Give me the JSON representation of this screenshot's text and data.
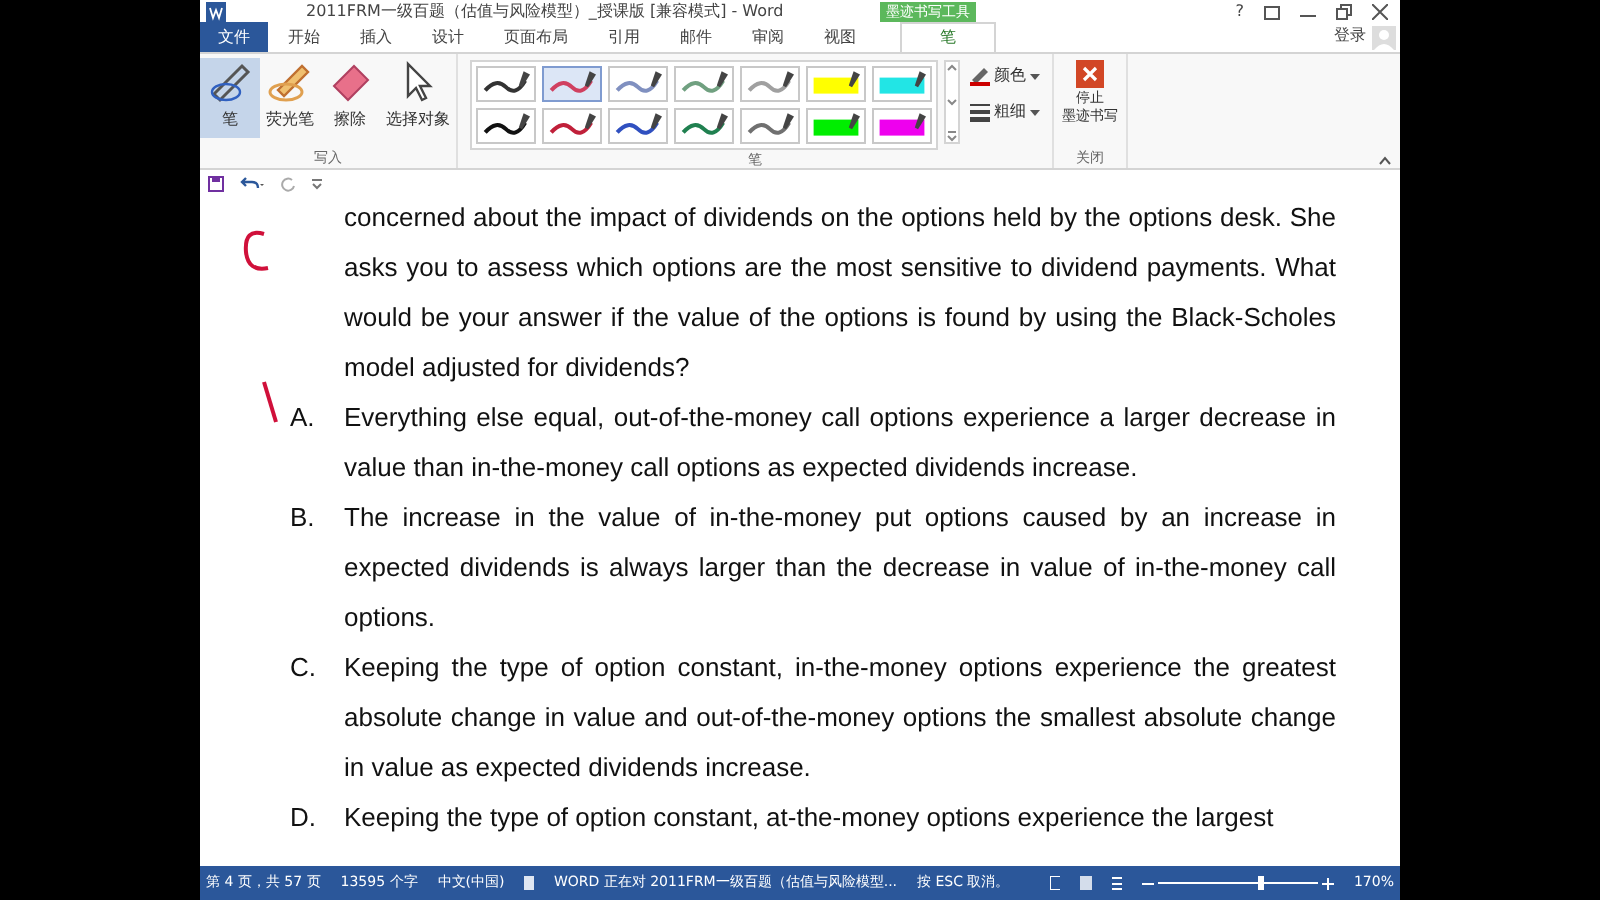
{
  "window": {
    "title": "2011FRM一级百题（估值与风险模型）_授课版 [兼容模式] - Word",
    "context_label": "墨迹书写工具",
    "account": "登录",
    "help": "?"
  },
  "tabs": [
    {
      "label": "文件",
      "selected": false,
      "kind": "file"
    },
    {
      "label": "开始",
      "selected": false,
      "kind": "tab"
    },
    {
      "label": "插入",
      "selected": false,
      "kind": "tab"
    },
    {
      "label": "设计",
      "selected": false,
      "kind": "tab"
    },
    {
      "label": "页面布局",
      "selected": false,
      "kind": "tab"
    },
    {
      "label": "引用",
      "selected": false,
      "kind": "tab"
    },
    {
      "label": "邮件",
      "selected": false,
      "kind": "tab"
    },
    {
      "label": "审阅",
      "selected": false,
      "kind": "tab"
    },
    {
      "label": "视图",
      "selected": false,
      "kind": "tab"
    },
    {
      "label": "笔",
      "selected": true,
      "kind": "tab"
    }
  ],
  "ribbon": {
    "write_group": {
      "label": "写入",
      "tools": [
        {
          "label": "笔",
          "selected": true,
          "kind": "pen"
        },
        {
          "label": "荧光笔",
          "selected": false,
          "kind": "highlighter"
        },
        {
          "label": "擦除",
          "selected": false,
          "kind": "eraser"
        },
        {
          "label": "选择对象",
          "selected": false,
          "kind": "select"
        }
      ]
    },
    "pens_group": {
      "label": "笔",
      "pens": [
        {
          "color": "#333333",
          "selected": false,
          "kind": "line"
        },
        {
          "color": "#d04060",
          "selected": true,
          "kind": "line"
        },
        {
          "color": "#8090c0",
          "selected": false,
          "kind": "line"
        },
        {
          "color": "#70a080",
          "selected": false,
          "kind": "line"
        },
        {
          "color": "#a0a0a0",
          "selected": false,
          "kind": "line"
        },
        {
          "color": "#ffff00",
          "selected": false,
          "kind": "highlight"
        },
        {
          "color": "#22e5e5",
          "selected": false,
          "kind": "highlight"
        },
        {
          "color": "#111111",
          "selected": false,
          "kind": "line"
        },
        {
          "color": "#c0203a",
          "selected": false,
          "kind": "line"
        },
        {
          "color": "#3050c0",
          "selected": false,
          "kind": "line"
        },
        {
          "color": "#208050",
          "selected": false,
          "kind": "line"
        },
        {
          "color": "#707070",
          "selected": false,
          "kind": "line"
        },
        {
          "color": "#00ee00",
          "selected": false,
          "kind": "highlight"
        },
        {
          "color": "#ee00ee",
          "selected": false,
          "kind": "highlight"
        }
      ],
      "color_label": "颜色",
      "thickness_label": "粗细"
    },
    "close_group": {
      "label": "关闭",
      "button_lines": [
        "停止",
        "墨迹书写"
      ]
    }
  },
  "document": {
    "stem": [
      "concerned about the impact of dividends on the options held by the options desk. She asks you to assess which options are the most sensitive to dividend payments. What would be your answer if the value of the options is found by using the Black-Scholes model adjusted for dividends?"
    ],
    "options": [
      {
        "letter": "A.",
        "text": "Everything else equal, out-of-the-money call options experience a larger decrease in value than in-the-money call options as expected dividends increase."
      },
      {
        "letter": "B.",
        "text": "The increase in the value of in-the-money put options caused by an increase in expected dividends is always larger than the decrease in value of in-the-money call options."
      },
      {
        "letter": "C.",
        "text": "Keeping the type of option constant, in-the-money options experience the greatest absolute change in value and out-of-the-money options the smallest absolute change in value as expected dividends increase."
      },
      {
        "letter": "D.",
        "text": "Keeping the type of option constant, at-the-money options experience the largest"
      }
    ]
  },
  "status_bar": {
    "page": "第 4 页，共 57 页",
    "words": "13595 个字",
    "language": "中文(中国)",
    "message": "WORD 正在对 2011FRM一级百题（估值与风险模型...",
    "hint": "按 ESC 取消。",
    "zoom": "170%",
    "level": 0.62
  }
}
